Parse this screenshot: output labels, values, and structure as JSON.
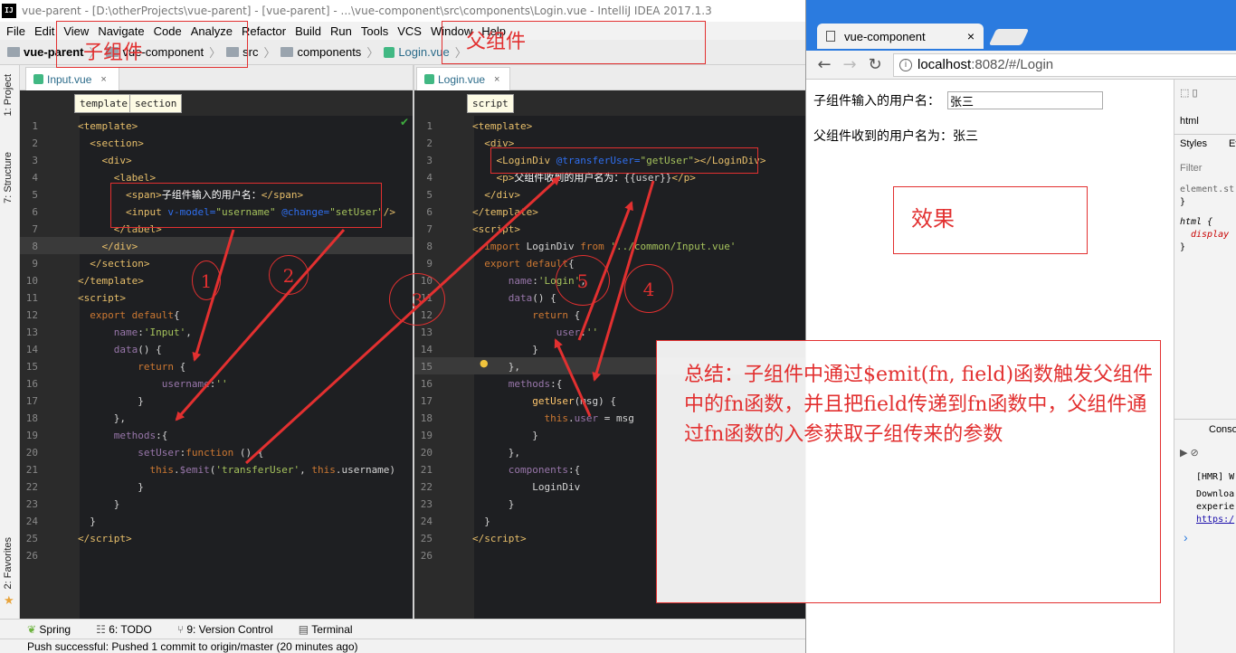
{
  "ide": {
    "title": "vue-parent - [D:\\otherProjects\\vue-parent] - [vue-parent] - ...\\vue-component\\src\\components\\Login.vue - IntelliJ IDEA 2017.1.3",
    "menu": [
      "File",
      "Edit",
      "View",
      "Navigate",
      "Code",
      "Analyze",
      "Refactor",
      "Build",
      "Run",
      "Tools",
      "VCS",
      "Window",
      "Help"
    ],
    "breadcrumb": [
      "vue-parent",
      "vue-component",
      "src",
      "components",
      "Login.vue"
    ],
    "left_tabs": [
      "1: Project",
      "7: Structure",
      "2: Favorites"
    ],
    "left_editor": {
      "tab": "Input.vue",
      "chips": [
        "template",
        "section"
      ],
      "lines": [
        "1",
        "2",
        "3",
        "4",
        "5",
        "6",
        "7",
        "8",
        "9",
        "10",
        "11",
        "12",
        "13",
        "14",
        "15",
        "16",
        "17",
        "18",
        "19",
        "20",
        "21",
        "22",
        "23",
        "24",
        "25",
        "26"
      ]
    },
    "right_editor": {
      "tab": "Login.vue",
      "chips": [
        "script"
      ],
      "lines": [
        "1",
        "2",
        "3",
        "4",
        "5",
        "6",
        "7",
        "8",
        "9",
        "10",
        "11",
        "12",
        "13",
        "14",
        "15",
        "16",
        "17",
        "18",
        "19",
        "20",
        "21",
        "22",
        "23",
        "24",
        "25",
        "26"
      ]
    },
    "toolwindows": [
      "Spring",
      "6: TODO",
      "9: Version Control",
      "Terminal"
    ],
    "status": "Push successful: Pushed 1 commit to origin/master (20 minutes ago)"
  },
  "browser": {
    "tab_title": "vue-component",
    "url_host": "localhost",
    "url_rest": ":8082/#/Login",
    "child_label": "子组件输入的用户名：",
    "child_value": "张三",
    "parent_text": "父组件收到的用户名为：张三",
    "devtools": {
      "html_tab": "html",
      "styles": "Styles",
      "ev": "Ev",
      "filter": "Filter",
      "element_style": "element.st",
      "brace": "}",
      "html_rule": "html {",
      "display": "display",
      "console": "Conso",
      "hmr": "[HMR] W",
      "download": "Downloa",
      "experi": "experie",
      "https": "https:/",
      "prompt": "›"
    }
  },
  "annotations": {
    "child": "子组件",
    "parent": "父组件",
    "effect": "效果",
    "summary": "总结：子组件中通过$emit(fn, field)函数触发父组件中的fn函数，并且把field传递到fn函数中，父组件通过fn函数的入参获取子组传来的参数",
    "numbers": [
      "1",
      "2",
      "3",
      "4",
      "5"
    ]
  },
  "colors": {
    "annotation_red": "#e23030",
    "chrome_blue": "#2b7bdf",
    "editor_bg": "#1e1f22"
  }
}
